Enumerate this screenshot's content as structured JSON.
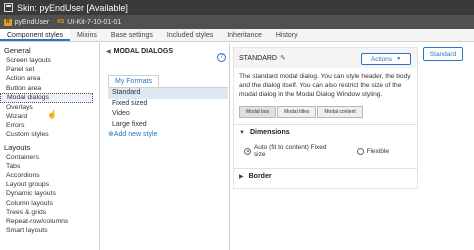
{
  "window": {
    "title": "Skin: pyEndUser [Available]",
    "subtitle": "pyEndUser",
    "ruleset": "UI-Kit-7-10-01-01",
    "badge_r": "R",
    "badge_rs": "RS"
  },
  "tabs": [
    "Component styles",
    "Mixins",
    "Base settings",
    "Included styles",
    "Inheritance",
    "History"
  ],
  "sidebar": {
    "general_heading": "General",
    "general_items": [
      "Screen layouts",
      "Panel set",
      "Action area",
      "Button area",
      "Modal dialogs",
      "Overlays",
      "Wizard",
      "Errors",
      "Custom styles"
    ],
    "layouts_heading": "Layouts",
    "layouts_items": [
      "Containers",
      "Tabs",
      "Accordions",
      "Layout groups",
      "Dynamic layouts",
      "Column layouts",
      "Trees & grids",
      "Repeat-row/columns",
      "Smart layouts"
    ]
  },
  "middle": {
    "title": "MODAL DIALOGS",
    "help_icon": "?",
    "tab": "My Formats",
    "formats": [
      "Standard",
      "Fixed sized",
      "Video",
      "Large fixed"
    ],
    "add_style": "Add new style"
  },
  "panel": {
    "title": "STANDARD",
    "actions_label": "Actions",
    "description": "The standard modal dialog. You can style header, the body and the dialog itself. You can also restrict the size of the modal dialog in the Modal Dialog Window styling.",
    "subtabs": [
      "Modal box",
      "Modal titles",
      "Modal content"
    ],
    "dimensions_label": "Dimensions",
    "radio_auto": "Auto (fit to content) Fixed size",
    "radio_flexible": "Flexible",
    "border_label": "Border"
  },
  "standard_button": "Standard",
  "colors": {
    "accent": "#2a75c7",
    "titlebar": "#3a3a3a",
    "badge": "#e0a020"
  }
}
